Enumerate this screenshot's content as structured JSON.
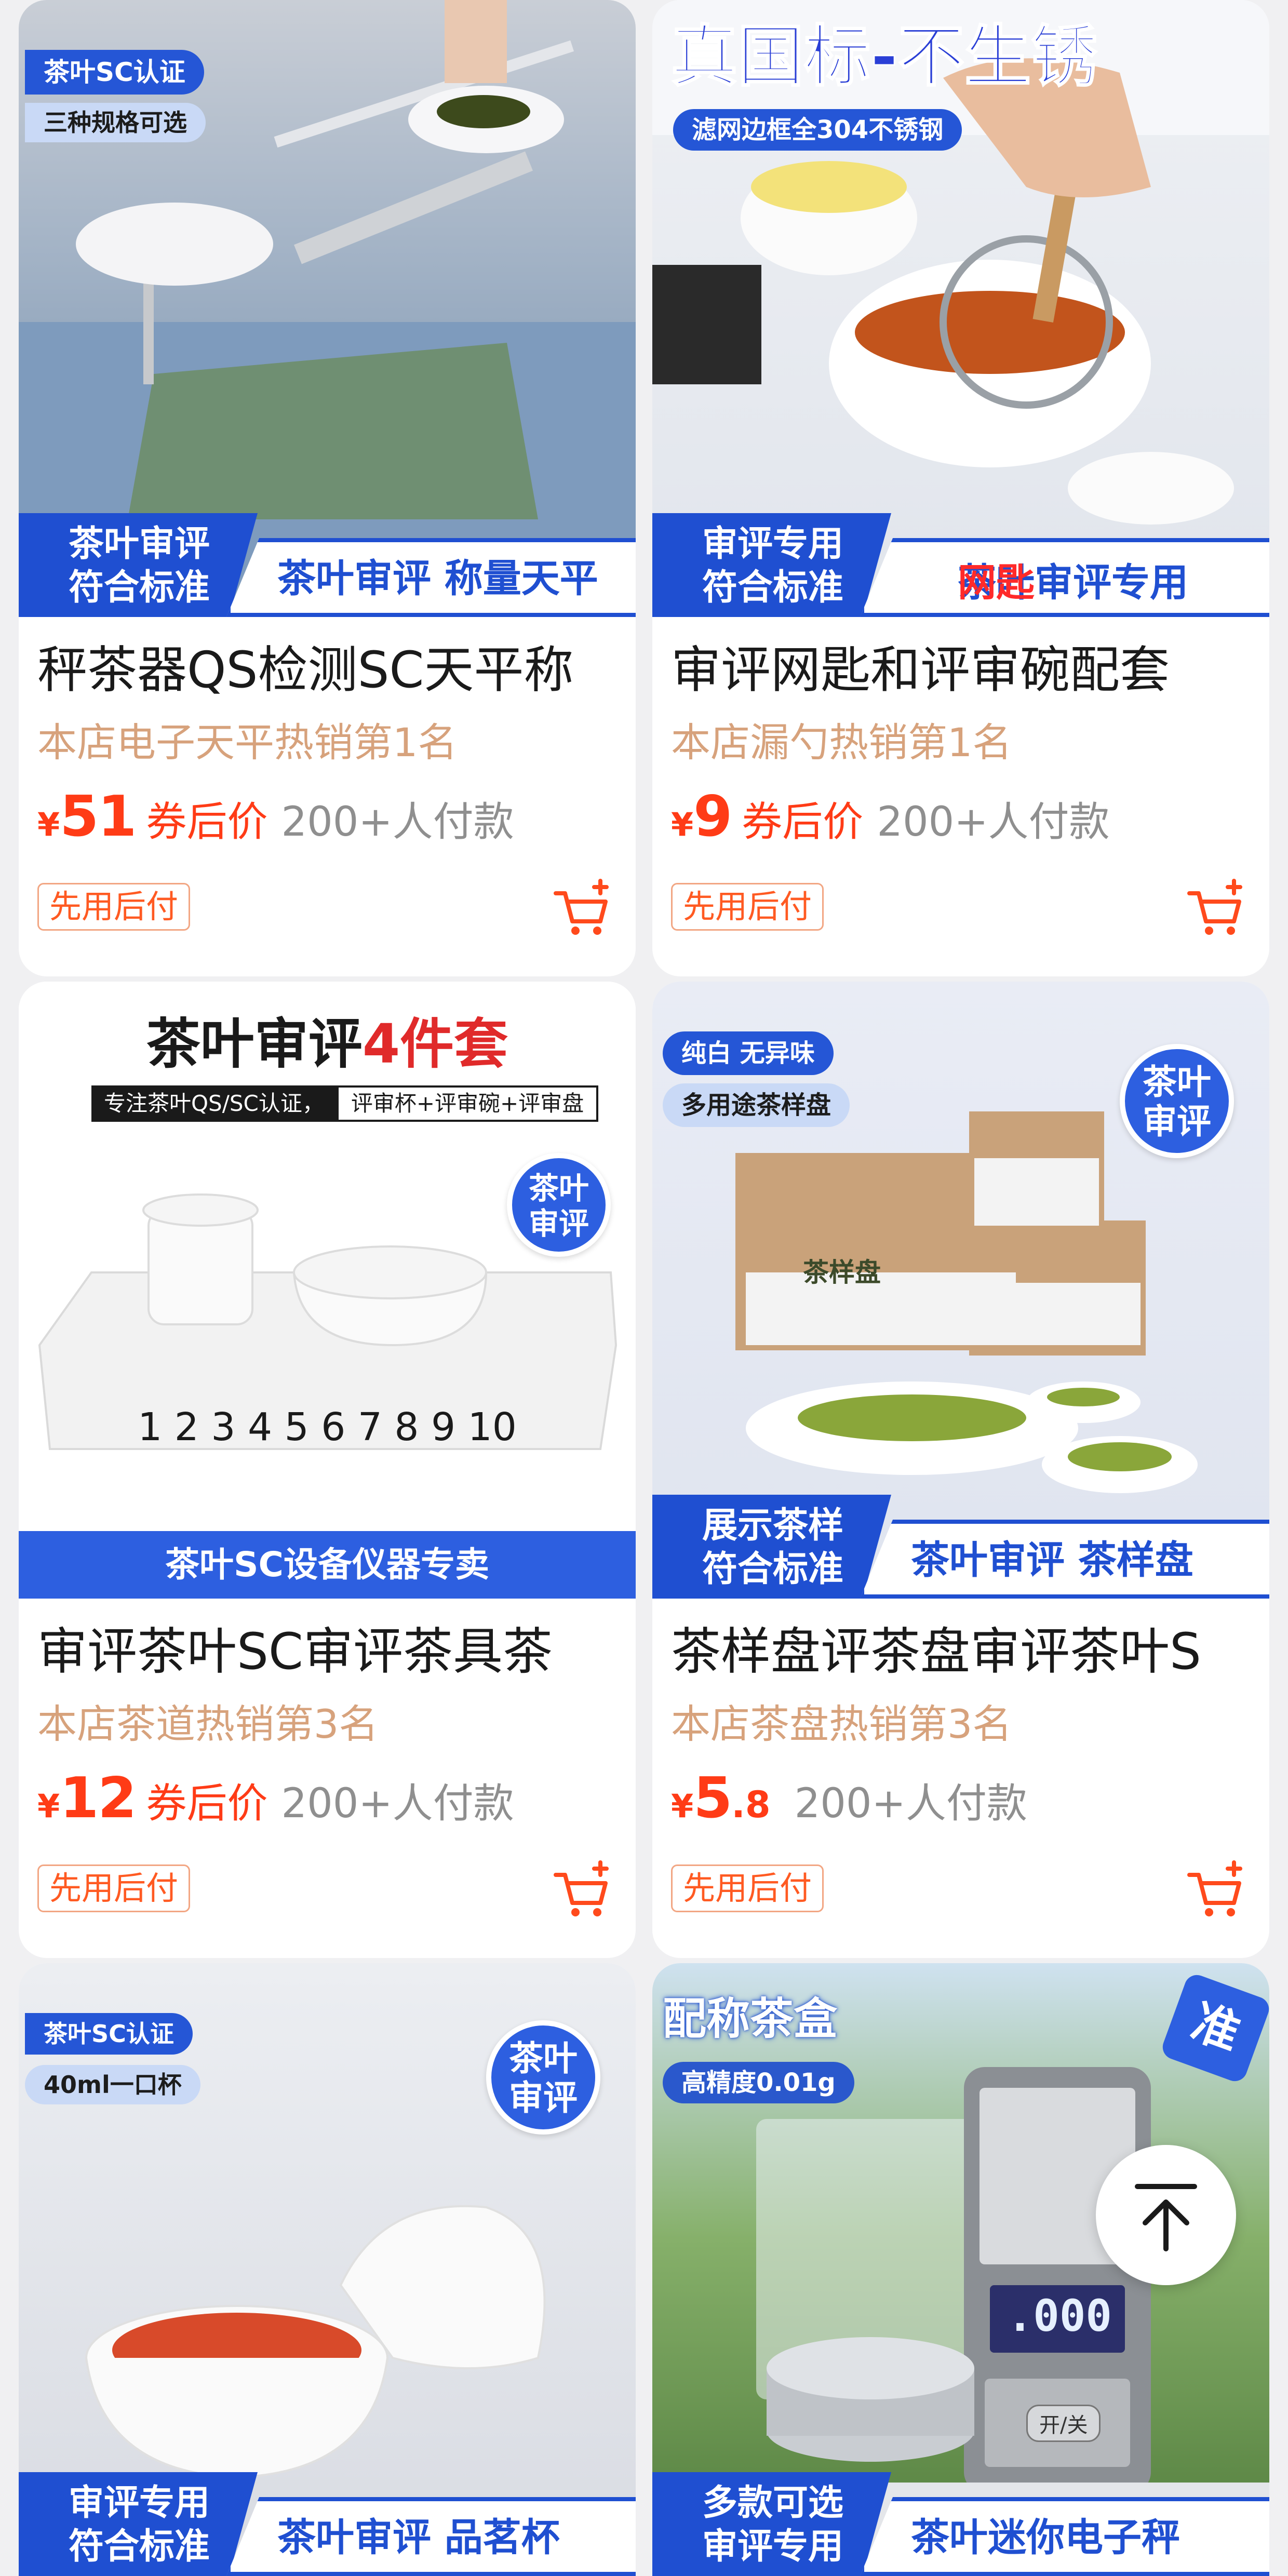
{
  "products": [
    {
      "title": "秤茶器QS检测SC天平称",
      "rank": "本店电子天平热销第1名",
      "price_int": "51",
      "price_dec": "",
      "price_tag": "券后价",
      "sold": "200+人付款",
      "pay_later": "先用后付",
      "image": {
        "badge1": "茶叶SC认证",
        "badge2": "三种规格可选",
        "banner_left": [
          "茶叶审评",
          "符合标准"
        ],
        "banner_right": "茶叶审评 称量天平"
      }
    },
    {
      "title": "审评网匙和评审碗配套",
      "rank": "本店漏勺热销第1名",
      "price_int": "9",
      "price_dec": "",
      "price_tag": "券后价",
      "sold": "200+人付款",
      "pay_later": "先用后付",
      "image": {
        "headline": "真国标-不生锈",
        "sub": "滤网边框全304不锈钢",
        "banner_left": [
          "审评专用",
          "符合标准"
        ],
        "banner_right": "茶叶审评专用",
        "banner_right_red": "网匙"
      }
    },
    {
      "title": "审评茶叶SC审评茶具茶",
      "rank": "本店茶道热销第3名",
      "price_int": "12",
      "price_dec": "",
      "price_tag": "券后价",
      "sold": "200+人付款",
      "pay_later": "先用后付",
      "image": {
        "headline": "茶叶审评",
        "headline_em": "4件套",
        "sub_left": "专注茶叶QS/SC认证，",
        "sub_right": "评审杯+评审碗+评审盘",
        "seal": [
          "茶叶",
          "审评"
        ],
        "numbers": "1 2 3 4 5 6 7 8 9 10",
        "footer": "茶叶SC设备仪器专卖"
      }
    },
    {
      "title": "茶样盘评茶盘审评茶叶S",
      "rank": "本店茶盘热销第3名",
      "price_int": "5",
      "price_dec": ".8",
      "price_tag": "",
      "sold": "200+人付款",
      "pay_later": "先用后付",
      "image": {
        "badge1": "纯白 无异味",
        "badge2": "多用途茶样盘",
        "seal": [
          "茶叶",
          "审评"
        ],
        "box_label": "茶样盘",
        "banner_left": [
          "展示茶样",
          "符合标准"
        ],
        "banner_right": "茶叶审评 茶样盘"
      }
    },
    {
      "title": "",
      "rank": "",
      "price_int": "",
      "price_dec": "",
      "price_tag": "",
      "sold": "",
      "pay_later": "",
      "image": {
        "badge1": "茶叶SC认证",
        "badge2": "40ml一口杯",
        "seal": [
          "茶叶",
          "审评"
        ],
        "banner_left": [
          "审评专用",
          "符合标准"
        ],
        "banner_right": "茶叶审评 品茗杯"
      }
    },
    {
      "title": "",
      "rank": "",
      "price_int": "",
      "price_dec": "",
      "price_tag": "",
      "sold": "",
      "pay_later": "",
      "image": {
        "badge1": "配称茶盒",
        "badge2": "高精度0.01g",
        "corner": "准",
        "display": ".000",
        "btn": "开/关",
        "banner_left": [
          "多款可选",
          "审评专用"
        ],
        "banner_right": "茶叶迷你电子秤"
      }
    }
  ],
  "currency": "¥",
  "colors": {
    "price": "#ff3b16",
    "brand_blue": "#1f4fd1",
    "rank": "#d7a27c"
  },
  "icons": {
    "cart": "cart-plus-icon",
    "back_to_top": "arrow-up-icon"
  }
}
